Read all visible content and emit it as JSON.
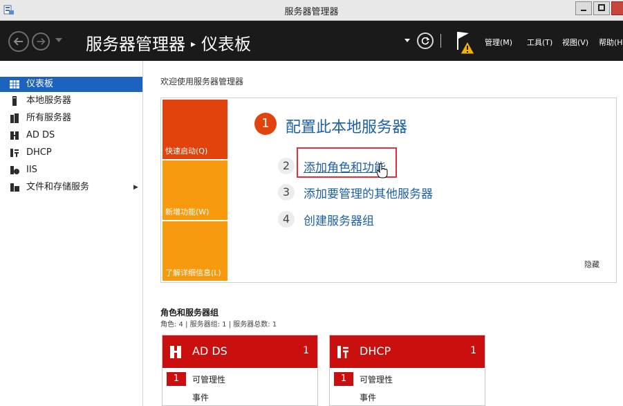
{
  "window": {
    "title": "服务器管理器"
  },
  "header": {
    "breadcrumb_root": "服务器管理器",
    "breadcrumb_sep": "▸",
    "breadcrumb_page": "仪表板",
    "menu": [
      "管理(M)",
      "工具(T)",
      "视图(V)",
      "帮助(H"
    ]
  },
  "sidebar": {
    "items": [
      {
        "label": "仪表板",
        "icon": "dashboard-icon",
        "active": true
      },
      {
        "label": "本地服务器",
        "icon": "server-icon"
      },
      {
        "label": "所有服务器",
        "icon": "servers-icon"
      },
      {
        "label": "AD DS",
        "icon": "ad-ds-icon"
      },
      {
        "label": "DHCP",
        "icon": "dhcp-icon"
      },
      {
        "label": "IIS",
        "icon": "iis-icon"
      },
      {
        "label": "文件和存储服务",
        "icon": "file-storage-icon",
        "has_submenu": true
      }
    ]
  },
  "main": {
    "welcome": "欢迎使用服务器管理器",
    "tiles": [
      "快速启动(Q)",
      "新增功能(W)",
      "了解详细信息(L)"
    ],
    "step1": {
      "num": "1",
      "label": "配置此本地服务器"
    },
    "steps": [
      {
        "num": "2",
        "label": "添加角色和功能"
      },
      {
        "num": "3",
        "label": "添加要管理的其他服务器"
      },
      {
        "num": "4",
        "label": "创建服务器组"
      }
    ],
    "hide": "隐藏",
    "roles_title": "角色和服务器组",
    "roles_summary": "角色: 4 | 服务器组: 1 | 服务器总数: 1",
    "cards": [
      {
        "name": "AD DS",
        "count": "1",
        "badge": "1",
        "manageability": "可管理性",
        "events": "事件"
      },
      {
        "name": "DHCP",
        "count": "1",
        "badge": "1",
        "manageability": "可管理性",
        "events": "事件"
      }
    ]
  },
  "colors": {
    "accent_blue": "#1c63c0",
    "link_blue": "#1c5fa8",
    "tile_red": "#e2430d",
    "tile_orange": "#f79a0e",
    "card_red": "#c9100e",
    "highlight_box": "#e0303c"
  }
}
